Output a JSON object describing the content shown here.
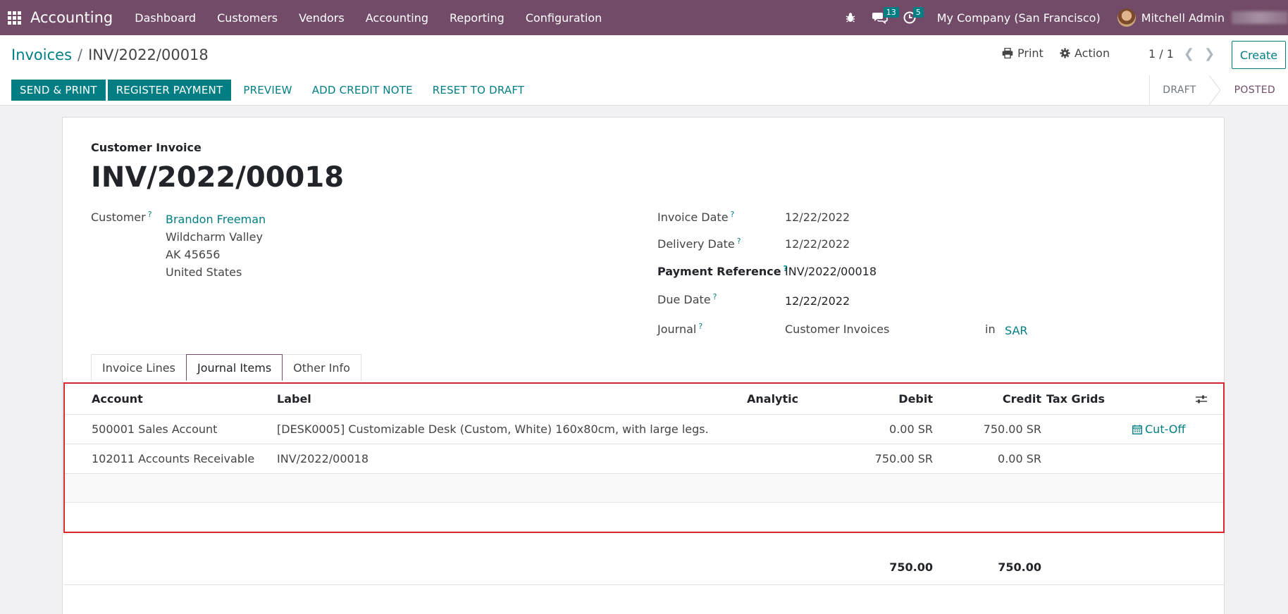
{
  "navbar": {
    "app_name": "Accounting",
    "menu": [
      "Dashboard",
      "Customers",
      "Vendors",
      "Accounting",
      "Reporting",
      "Configuration"
    ],
    "messages_count": "13",
    "activities_count": "5",
    "company": "My Company (San Francisco)",
    "user": "Mitchell Admin"
  },
  "control": {
    "breadcrumb_parent": "Invoices",
    "breadcrumb_sep": "/",
    "breadcrumb_current": "INV/2022/00018",
    "print_label": "Print",
    "action_label": "Action",
    "pager": "1 / 1",
    "create_label": "Create",
    "buttons": {
      "send_print": "SEND & PRINT",
      "register_payment": "REGISTER PAYMENT",
      "preview": "PREVIEW",
      "add_credit_note": "ADD CREDIT NOTE",
      "reset_to_draft": "RESET TO DRAFT"
    },
    "status": {
      "draft": "DRAFT",
      "posted": "POSTED",
      "current": "POSTED"
    }
  },
  "form": {
    "doc_type": "Customer Invoice",
    "doc_name": "INV/2022/00018",
    "customer_label": "Customer",
    "customer": {
      "name": "Brandon Freeman",
      "street": "Wildcharm Valley",
      "city_zip": "AK 45656",
      "country": "United States"
    },
    "invoice_date_label": "Invoice Date",
    "invoice_date": "12/22/2022",
    "delivery_date_label": "Delivery Date",
    "delivery_date": "12/22/2022",
    "payment_ref_label": "Payment Reference",
    "payment_ref": "INV/2022/00018",
    "due_date_label": "Due Date",
    "due_date": "12/22/2022",
    "journal_label": "Journal",
    "journal": "Customer Invoices",
    "in_label": "in",
    "currency": "SAR",
    "help_mark": "?"
  },
  "tabs": [
    "Invoice Lines",
    "Journal Items",
    "Other Info"
  ],
  "active_tab": "Journal Items",
  "journal_items": {
    "columns": {
      "account": "Account",
      "label": "Label",
      "analytic": "Analytic",
      "debit": "Debit",
      "credit": "Credit",
      "tax_grids": "Tax Grids"
    },
    "rows": [
      {
        "account": "500001 Sales Account",
        "label": "[DESK0005] Customizable Desk (Custom, White) 160x80cm, with large legs.",
        "debit": "0.00 SR",
        "credit": "750.00 SR",
        "action": "Cut-Off"
      },
      {
        "account": "102011 Accounts Receivable",
        "label": "INV/2022/00018",
        "debit": "750.00 SR",
        "credit": "0.00 SR",
        "action": ""
      }
    ],
    "total_debit": "750.00",
    "total_credit": "750.00"
  },
  "colors": {
    "brand": "#714b67",
    "accent": "#017e84",
    "highlight_border": "#d9272e"
  }
}
